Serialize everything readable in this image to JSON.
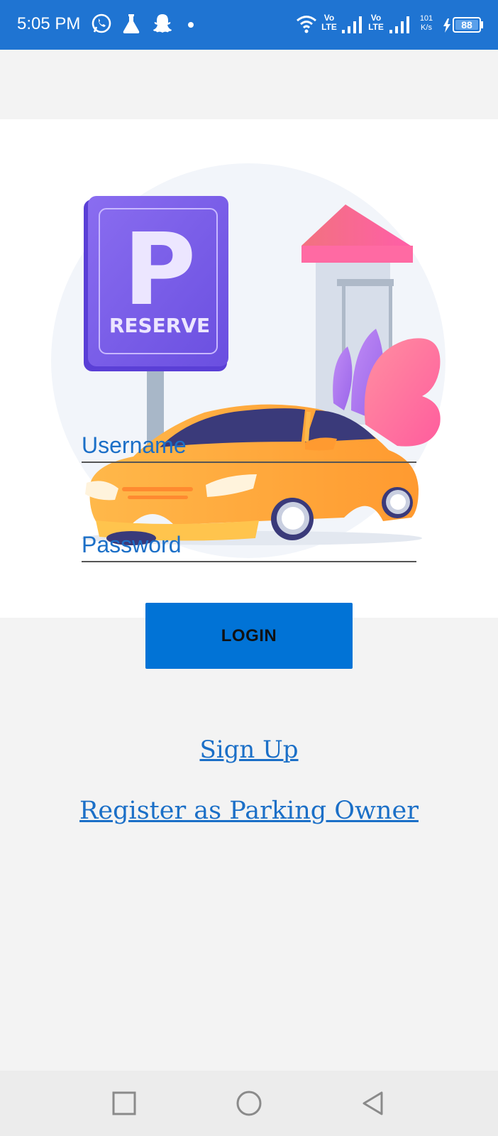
{
  "status_bar": {
    "time": "5:05 PM",
    "net_lte_1_top": "Vo",
    "net_lte_1_bottom": "LTE",
    "net_lte_2_top": "Vo",
    "net_lte_2_bottom": "LTE",
    "speed_value": "101",
    "speed_unit": "K/s",
    "battery": "88",
    "icons": [
      "whatsapp-icon",
      "flask-icon",
      "snapchat-icon",
      "dot-icon",
      "wifi-icon",
      "signal-icon",
      "signal-icon",
      "charging-icon",
      "battery-icon"
    ]
  },
  "hero": {
    "sign_letter": "P",
    "sign_text": "RESERVE"
  },
  "form": {
    "username_placeholder": "Username",
    "password_placeholder": "Password",
    "login_label": "LOGIN"
  },
  "links": {
    "signup": "Sign Up",
    "register_owner": "Register as Parking Owner"
  },
  "colors": {
    "status_bar": "#1f74d2",
    "accent": "#0173d6",
    "link": "#1b6fc7",
    "background": "#f3f3f3"
  }
}
